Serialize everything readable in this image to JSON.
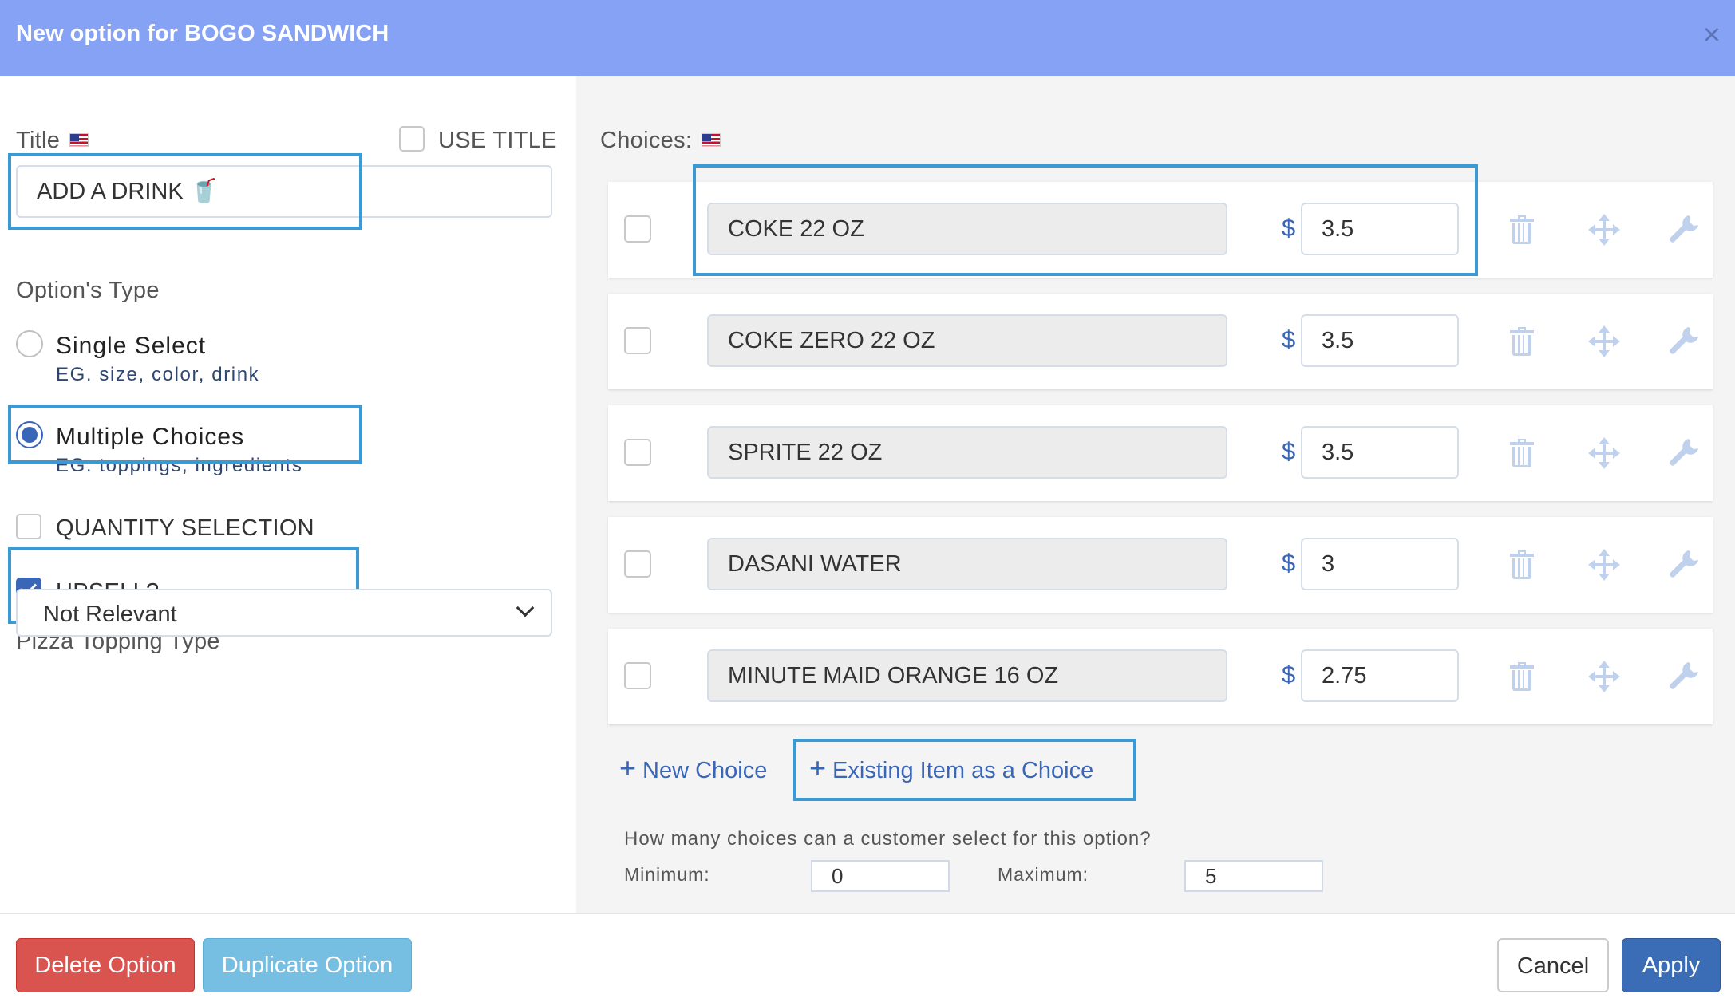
{
  "modal": {
    "title": "New option for BOGO SANDWICH",
    "close_symbol": "×"
  },
  "left": {
    "title_label": "Title",
    "use_title_label": "USE TITLE",
    "use_title_checked": false,
    "title_value": "ADD A DRINK 🥤",
    "option_type_label": "Option's Type",
    "single_select": {
      "label": "Single Select",
      "hint": "EG. size, color, drink",
      "checked": false
    },
    "multiple_choices": {
      "label": "Multiple Choices",
      "hint": "EG. toppings, ingredients",
      "checked": true
    },
    "quantity_selection": {
      "label": "QUANTITY SELECTION",
      "checked": false
    },
    "upsell": {
      "label": "UPSELL?",
      "checked": true
    },
    "pizza_topping_label": "Pizza Topping Type",
    "pizza_topping_value": "Not Relevant"
  },
  "right": {
    "choices_label": "Choices:",
    "currency": "$",
    "choices": [
      {
        "name": "COKE 22 OZ",
        "price": "3.5"
      },
      {
        "name": "COKE ZERO 22 OZ",
        "price": "3.5"
      },
      {
        "name": "SPRITE 22 OZ",
        "price": "3.5"
      },
      {
        "name": "DASANI WATER",
        "price": "3"
      },
      {
        "name": "MINUTE MAID ORANGE 16 OZ",
        "price": "2.75"
      }
    ],
    "new_choice_label": "New Choice",
    "existing_item_label": "Existing Item as a Choice",
    "plus_symbol": "+",
    "question": "How many choices can a customer select for this option?",
    "minimum_label": "Minimum:",
    "minimum_value": "0",
    "maximum_label": "Maximum:",
    "maximum_value": "5"
  },
  "footer": {
    "delete_label": "Delete Option",
    "duplicate_label": "Duplicate Option",
    "cancel_label": "Cancel",
    "apply_label": "Apply"
  },
  "icons": {
    "flag": "us-flag-icon",
    "close": "close-icon",
    "trash": "trash-icon",
    "move": "move-arrows-icon",
    "wrench": "wrench-icon",
    "chevron": "chevron-down-icon",
    "plus": "plus-icon"
  },
  "colors": {
    "header": "#86a2f5",
    "accent": "#3a66b8",
    "highlight": "#3b9ad4",
    "danger": "#d9534f",
    "info": "#76bfe2",
    "primary": "#3a6db5"
  }
}
